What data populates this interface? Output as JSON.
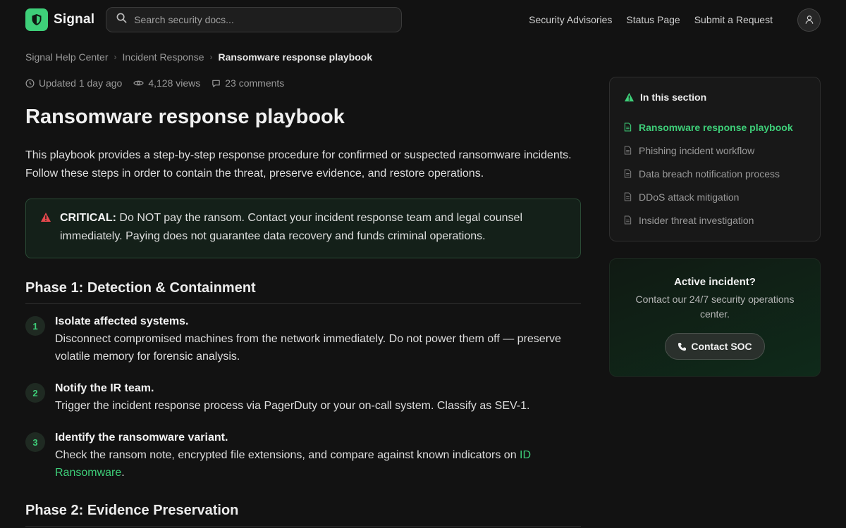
{
  "header": {
    "brand": "Signal",
    "search_placeholder": "Search security docs...",
    "nav": [
      "Security Advisories",
      "Status Page",
      "Submit a Request"
    ]
  },
  "breadcrumb": [
    "Signal Help Center",
    "Incident Response",
    "Ransomware response playbook"
  ],
  "meta": {
    "updated": "Updated 1 day ago",
    "views": "4,128 views",
    "comments": "23 comments"
  },
  "article": {
    "title": "Ransomware response playbook",
    "intro": "This playbook provides a step-by-step response procedure for confirmed or suspected ransomware incidents. Follow these steps in order to contain the threat, preserve evidence, and restore operations.",
    "callout": {
      "label": "CRITICAL:",
      "text": " Do NOT pay the ransom. Contact your incident response team and legal counsel immediately. Paying does not guarantee data recovery and funds criminal operations."
    },
    "phase1": "Phase 1: Detection & Containment",
    "steps": [
      {
        "num": "1",
        "title": "Isolate affected systems.",
        "text": "Disconnect compromised machines from the network immediately. Do not power them off — preserve volatile memory for forensic analysis."
      },
      {
        "num": "2",
        "title": "Notify the IR team.",
        "text": "Trigger the incident response process via PagerDuty or your on-call system. Classify as SEV-1."
      },
      {
        "num": "3",
        "title": "Identify the ransomware variant.",
        "text": "Check the ransom note, encrypted file extensions, and compare against known indicators on ",
        "link": "ID Ransomware",
        "end": "."
      }
    ],
    "phase2": "Phase 2: Evidence Preservation"
  },
  "toc": {
    "title": "In this section",
    "items": [
      "Ransomware response playbook",
      "Phishing incident workflow",
      "Data breach notification process",
      "DDoS attack mitigation",
      "Insider threat investigation"
    ]
  },
  "incident": {
    "title": "Active incident?",
    "desc": "Contact our 24/7 security operations center.",
    "button": "Contact SOC"
  },
  "colors": {
    "accent": "#3ecf79",
    "background": "#121212",
    "danger": "#e5484d"
  }
}
